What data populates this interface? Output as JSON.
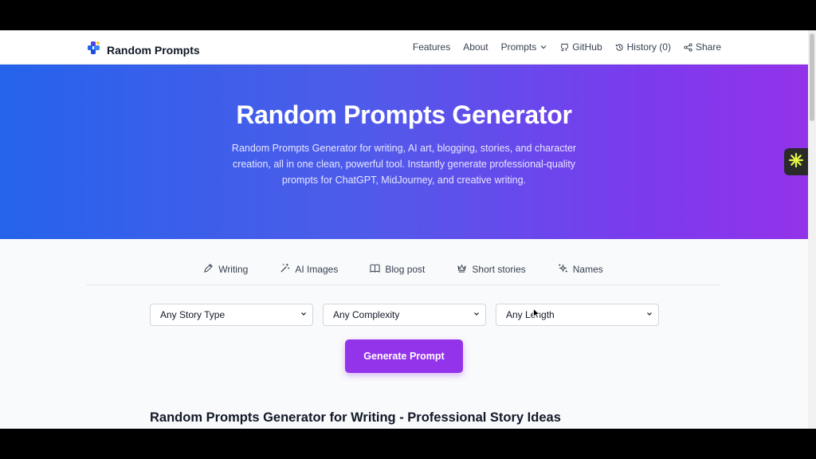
{
  "brand": {
    "name": "Random Prompts",
    "icon": "puzzle-icon"
  },
  "nav": {
    "features": "Features",
    "about": "About",
    "prompts": "Prompts",
    "github": "GitHub",
    "history": "History (0)",
    "share": "Share"
  },
  "hero": {
    "title": "Random Prompts Generator",
    "description": "Random Prompts Generator for writing, AI art, blogging, stories, and character creation, all in one clean, powerful tool. Instantly generate professional-quality prompts for ChatGPT, MidJourney, and creative writing."
  },
  "tabs": [
    {
      "label": "Writing",
      "icon": "pen-icon"
    },
    {
      "label": "AI Images",
      "icon": "magic-wand-icon"
    },
    {
      "label": "Blog post",
      "icon": "book-icon"
    },
    {
      "label": "Short stories",
      "icon": "crown-icon"
    },
    {
      "label": "Names",
      "icon": "sparkles-icon"
    }
  ],
  "filters": {
    "story_type": "Any Story Type",
    "complexity": "Any Complexity",
    "length": "Any Length"
  },
  "generate_button": "Generate Prompt",
  "section_title": "Random Prompts Generator for Writing - Professional Story Ideas",
  "colors": {
    "hero_gradient_start": "#2563eb",
    "hero_gradient_end": "#9333ea",
    "button": "#9333ea"
  }
}
